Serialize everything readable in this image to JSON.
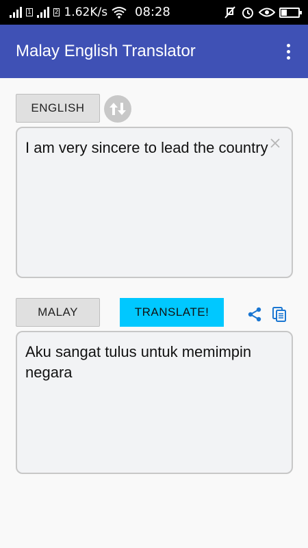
{
  "status_bar": {
    "network_speed": "1.62K/s",
    "time": "08:28",
    "battery_percent": 0.35
  },
  "app_bar": {
    "title": "Malay English Translator",
    "menu_icon": "more-vert-icon"
  },
  "source": {
    "language_label": "ENGLISH",
    "text": "I am very sincere to lead the country",
    "clear_icon": "close-icon",
    "swap_icon": "swap-vertical-icon"
  },
  "target": {
    "language_label": "MALAY",
    "translate_label": "TRANSLATE!",
    "text": "Aku sangat tulus untuk memimpin negara",
    "share_icon": "share-icon",
    "copy_icon": "copy-icon"
  },
  "colors": {
    "app_bar": "#3f51b5",
    "translate_button": "#00c8ff",
    "icon_accent": "#1976d2"
  }
}
